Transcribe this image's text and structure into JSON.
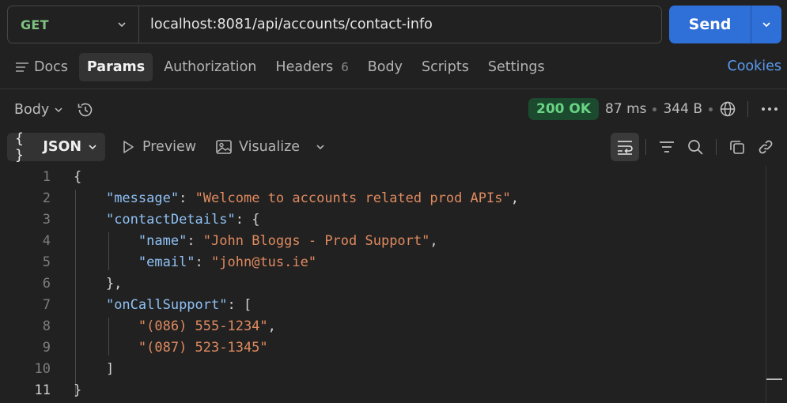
{
  "request": {
    "method": "GET",
    "url": "localhost:8081/api/accounts/contact-info",
    "send_label": "Send"
  },
  "tabs": [
    {
      "label": "Docs"
    },
    {
      "label": "Params",
      "active": true
    },
    {
      "label": "Authorization"
    },
    {
      "label": "Headers",
      "count": "6"
    },
    {
      "label": "Body"
    },
    {
      "label": "Scripts"
    },
    {
      "label": "Settings"
    }
  ],
  "cookies_label": "Cookies",
  "response": {
    "section_label": "Body",
    "status": "200 OK",
    "time": "87 ms",
    "size": "344 B",
    "status_color": "#69d384"
  },
  "viewer": {
    "format_label": "JSON",
    "preview_label": "Preview",
    "visualize_label": "Visualize"
  },
  "code": {
    "current_line": 11,
    "lines": [
      {
        "n": "1",
        "t": [
          [
            "p",
            "{"
          ]
        ]
      },
      {
        "n": "2",
        "t": [
          [
            "p",
            "    "
          ],
          [
            "k",
            "\"message\""
          ],
          [
            "p",
            ": "
          ],
          [
            "s",
            "\"Welcome to accounts related prod APIs\""
          ],
          [
            "p",
            ","
          ]
        ]
      },
      {
        "n": "3",
        "t": [
          [
            "p",
            "    "
          ],
          [
            "k",
            "\"contactDetails\""
          ],
          [
            "p",
            ": {"
          ]
        ]
      },
      {
        "n": "4",
        "t": [
          [
            "p",
            "        "
          ],
          [
            "k",
            "\"name\""
          ],
          [
            "p",
            ": "
          ],
          [
            "s",
            "\"John Bloggs - Prod Support\""
          ],
          [
            "p",
            ","
          ]
        ]
      },
      {
        "n": "5",
        "t": [
          [
            "p",
            "        "
          ],
          [
            "k",
            "\"email\""
          ],
          [
            "p",
            ": "
          ],
          [
            "s",
            "\"john@tus.ie\""
          ]
        ]
      },
      {
        "n": "6",
        "t": [
          [
            "p",
            "    },"
          ]
        ]
      },
      {
        "n": "7",
        "t": [
          [
            "p",
            "    "
          ],
          [
            "k",
            "\"onCallSupport\""
          ],
          [
            "p",
            ": ["
          ]
        ]
      },
      {
        "n": "8",
        "t": [
          [
            "p",
            "        "
          ],
          [
            "s",
            "\"(086) 555-1234\""
          ],
          [
            "p",
            ","
          ]
        ]
      },
      {
        "n": "9",
        "t": [
          [
            "p",
            "        "
          ],
          [
            "s",
            "\"(087) 523-1345\""
          ]
        ]
      },
      {
        "n": "10",
        "t": [
          [
            "p",
            "    ]"
          ]
        ]
      },
      {
        "n": "11",
        "t": [
          [
            "p",
            "}"
          ]
        ]
      }
    ]
  },
  "icons": {
    "method_dropdown": "chevron-down-icon",
    "send_dropdown": "chevron-down-icon",
    "docs": "lines-icon",
    "history": "history-icon",
    "globe": "globe-icon",
    "more": "more-horizontal-icon",
    "preview": "play-icon",
    "visualize": "image-icon",
    "wrap": "wrap-lines-icon",
    "filter": "filter-icon",
    "search": "search-icon",
    "copy": "copy-icon",
    "link": "link-icon"
  }
}
